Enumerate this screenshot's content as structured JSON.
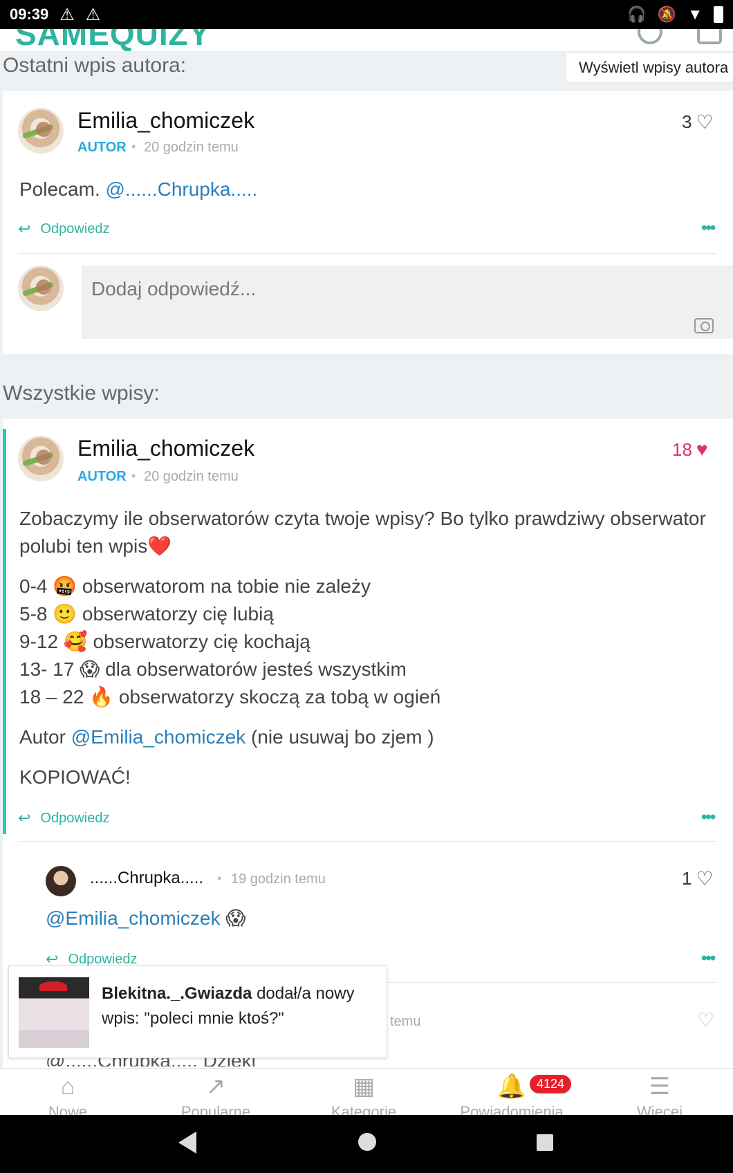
{
  "status_bar": {
    "time": "09:39"
  },
  "app": {
    "logo_text": "SAMEQUIZY"
  },
  "latest_section": {
    "title": "Ostatni wpis autora:",
    "show_author_posts": "Wyświetl wpisy autora"
  },
  "latest_post": {
    "username": "Emilia_chomiczek",
    "role": "AUTOR",
    "time": "20 godzin temu",
    "likes": "3",
    "text_prefix": "Polecam. ",
    "mention": "@......Chrupka.....",
    "reply_label": "Odpowiedz",
    "more_label": "•••",
    "reply_placeholder": "Dodaj odpowiedź..."
  },
  "all_section": {
    "title": "Wszystkie wpisy:"
  },
  "main_post": {
    "username": "Emilia_chomiczek",
    "role": "AUTOR",
    "time": "20 godzin temu",
    "likes": "18",
    "intro": "Zobaczymy ile obserwatorów czyta twoje wpisy? Bo tylko prawdziwy obserwator polubi ten wpis❤️",
    "lines": [
      "0-4 🤬 obserwatorom na tobie nie zależy",
      "5-8 🙂 obserwatorzy cię lubią",
      "9-12 🥰 obserwatorzy cię kochają",
      "13- 17 😱 dla obserwatorów jesteś wszystkim",
      "18 – 22 🔥 obserwatorzy skoczą za tobą w ogień"
    ],
    "autor_prefix": "Autor ",
    "autor_mention": "@Emilia_chomiczek",
    "autor_suffix": " (nie usuwaj bo zjem )",
    "copy_text": "KOPIOWAĆ!",
    "reply_label": "Odpowiedz",
    "more_label": "•••"
  },
  "comment_1": {
    "username": "......Chrupka.....",
    "time": "19 godzin temu",
    "likes": "1",
    "mention": "@Emilia_chomiczek",
    "emoji": " 😱",
    "reply_label": "Odpowiedz",
    "more_label": "•••"
  },
  "comment_2_partial": {
    "time_fragment": "temu",
    "text_fragment": "@......Chrupka..... Dzięki"
  },
  "toast": {
    "user": "Blekitna._.Gwiazda",
    "message": " dodał/a nowy wpis: \"poleci mnie ktoś?\""
  },
  "bottom_nav": {
    "items": [
      {
        "label": "Nowe",
        "icon": "home-icon"
      },
      {
        "label": "Popularne",
        "icon": "trending-icon"
      },
      {
        "label": "Kategorie",
        "icon": "grid-icon"
      },
      {
        "label": "Powiadomienia",
        "icon": "bell-icon"
      },
      {
        "label": "Więcej",
        "icon": "menu-icon"
      }
    ],
    "notifications_badge": "4124"
  }
}
